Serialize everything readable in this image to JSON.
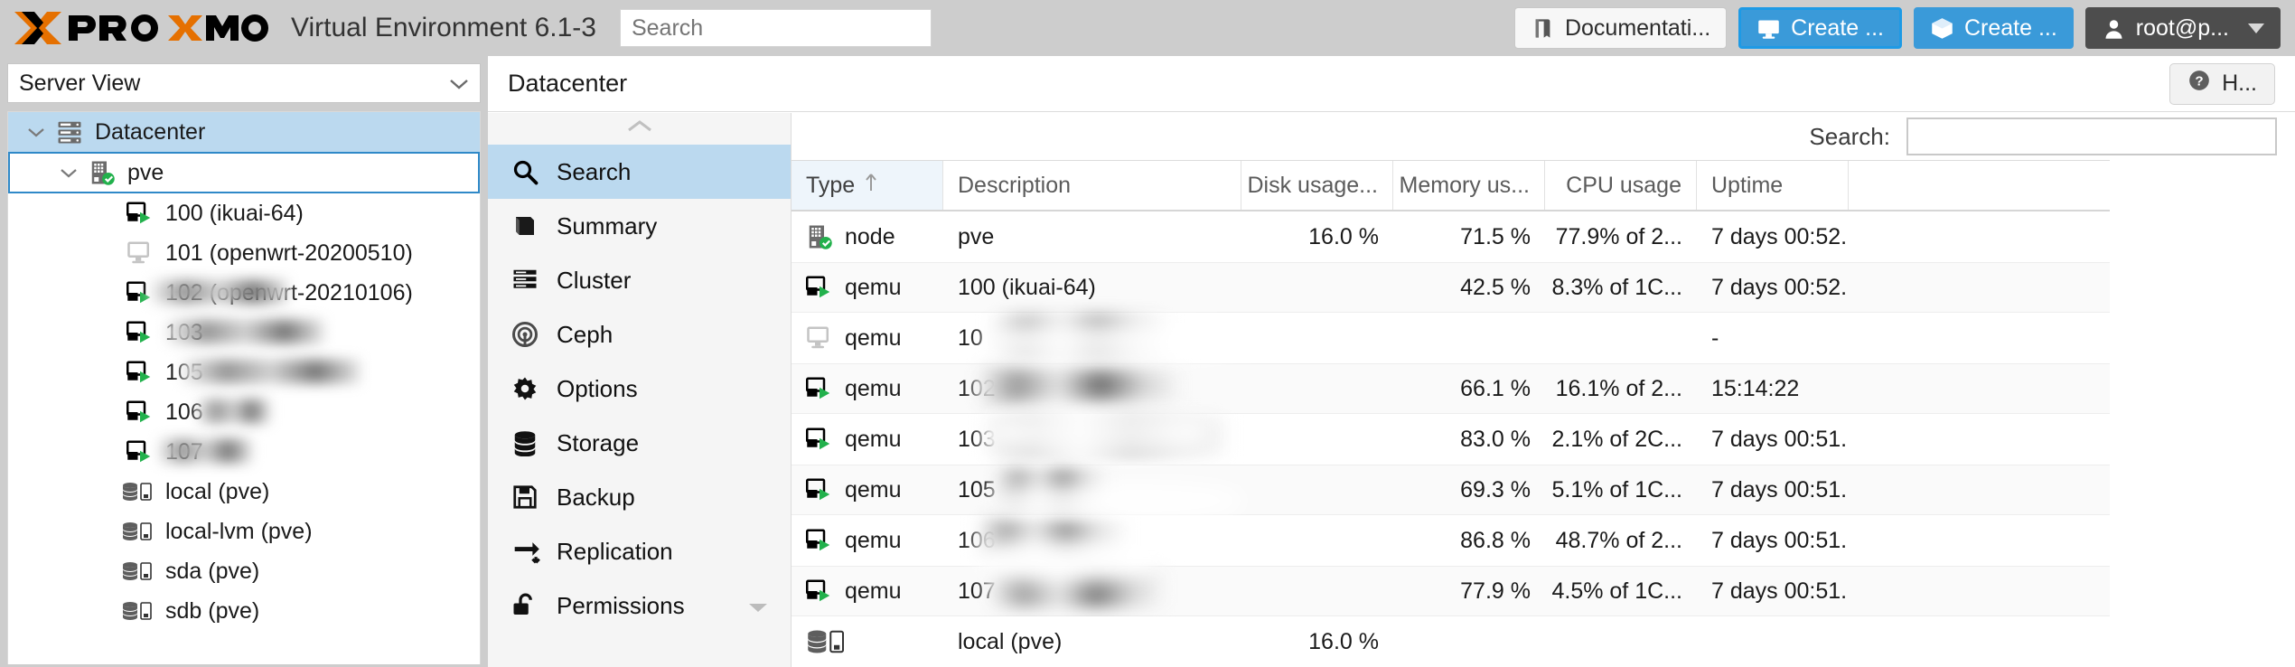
{
  "header": {
    "product": "PROXMOX",
    "title": "Virtual Environment 6.1-3",
    "search_placeholder": "Search",
    "buttons": {
      "documentation": "Documentati...",
      "create_vm": "Create ...",
      "create_ct": "Create ...",
      "user": "root@p..."
    }
  },
  "sidebar": {
    "view_label": "Server View",
    "items": [
      {
        "label": "Datacenter",
        "icon": "datacenter-icon",
        "state": "selected",
        "indent": 1,
        "twisty": "chevron-down"
      },
      {
        "label": "pve",
        "icon": "node-icon",
        "state": "focused",
        "indent": 2,
        "twisty": "chevron-down"
      },
      {
        "label": "100 (ikuai-64)",
        "icon": "qemu-running-icon",
        "state": "normal",
        "indent": 3,
        "twisty": "none"
      },
      {
        "label": "101 (openwrt-20200510)",
        "icon": "qemu-stopped-icon",
        "state": "normal",
        "indent": 3,
        "twisty": "none"
      },
      {
        "label": "102 (openwrt-20210106)",
        "icon": "qemu-running-icon",
        "state": "normal",
        "indent": 3,
        "twisty": "none",
        "redacted": true
      },
      {
        "label": "103",
        "icon": "qemu-running-icon",
        "state": "normal",
        "indent": 3,
        "twisty": "none",
        "redacted": true
      },
      {
        "label": "105",
        "icon": "qemu-running-icon",
        "state": "normal",
        "indent": 3,
        "twisty": "none",
        "redacted": true
      },
      {
        "label": "106",
        "icon": "qemu-running-icon",
        "state": "normal",
        "indent": 3,
        "twisty": "none",
        "redacted": true
      },
      {
        "label": "107",
        "icon": "qemu-running-icon",
        "state": "normal",
        "indent": 3,
        "twisty": "none",
        "redacted": true
      },
      {
        "label": "local (pve)",
        "icon": "storage-icon",
        "state": "normal",
        "indent": 3,
        "twisty": "none"
      },
      {
        "label": "local-lvm (pve)",
        "icon": "storage-icon",
        "state": "normal",
        "indent": 3,
        "twisty": "none"
      },
      {
        "label": "sda (pve)",
        "icon": "storage-icon",
        "state": "normal",
        "indent": 3,
        "twisty": "none"
      },
      {
        "label": "sdb (pve)",
        "icon": "storage-icon",
        "state": "normal",
        "indent": 3,
        "twisty": "none"
      }
    ]
  },
  "breadcrumb": {
    "label": "Datacenter"
  },
  "help_button": {
    "label": "H...",
    "icon": "question-circle-icon"
  },
  "menu": {
    "scroll_up_icon": "chevron-up-icon",
    "items": [
      {
        "label": "Search",
        "icon": "search-icon",
        "selected": true
      },
      {
        "label": "Summary",
        "icon": "book-icon",
        "selected": false
      },
      {
        "label": "Cluster",
        "icon": "server-stack-icon",
        "selected": false
      },
      {
        "label": "Ceph",
        "icon": "ceph-icon",
        "selected": false
      },
      {
        "label": "Options",
        "icon": "gear-icon",
        "selected": false
      },
      {
        "label": "Storage",
        "icon": "database-icon",
        "selected": false
      },
      {
        "label": "Backup",
        "icon": "floppy-disk-icon",
        "selected": false
      },
      {
        "label": "Replication",
        "icon": "replication-icon",
        "selected": false
      },
      {
        "label": "Permissions",
        "icon": "unlock-icon",
        "selected": false,
        "expandable": true
      }
    ]
  },
  "table_search": {
    "label": "Search:",
    "value": ""
  },
  "chart_data": {
    "type": "table",
    "title": "Datacenter Search",
    "columns": [
      "Type",
      "Description",
      "Disk usage...",
      "Memory us...",
      "CPU usage",
      "Uptime"
    ],
    "sorted_by": "Type",
    "sort_direction": "asc",
    "rows": [
      {
        "icon": "node-icon",
        "type": "node",
        "description": "pve",
        "disk": "16.0 %",
        "memory": "71.5 %",
        "cpu": "77.9% of 2...",
        "uptime": "7 days 00:52...",
        "redacted": false
      },
      {
        "icon": "qemu-running-icon",
        "type": "qemu",
        "description": "100 (ikuai-64)",
        "disk": "",
        "memory": "42.5 %",
        "cpu": "8.3% of 1C...",
        "uptime": "7 days 00:52...",
        "redacted": false
      },
      {
        "icon": "qemu-stopped-icon",
        "type": "qemu",
        "description": "10",
        "disk": "",
        "memory": "",
        "cpu": "",
        "uptime": "-",
        "redacted": true
      },
      {
        "icon": "qemu-running-icon",
        "type": "qemu",
        "description": "102",
        "disk": "",
        "memory": "66.1 %",
        "cpu": "16.1% of 2...",
        "uptime": "15:14:22",
        "redacted": true
      },
      {
        "icon": "qemu-running-icon",
        "type": "qemu",
        "description": "103",
        "disk": "",
        "memory": "83.0 %",
        "cpu": "2.1% of 2C...",
        "uptime": "7 days 00:51...",
        "redacted": true
      },
      {
        "icon": "qemu-running-icon",
        "type": "qemu",
        "description": "105",
        "disk": "",
        "memory": "69.3 %",
        "cpu": "5.1% of 1C...",
        "uptime": "7 days 00:51...",
        "redacted": true
      },
      {
        "icon": "qemu-running-icon",
        "type": "qemu",
        "description": "106",
        "disk": "",
        "memory": "86.8 %",
        "cpu": "48.7% of 2...",
        "uptime": "7 days 00:51...",
        "redacted": true
      },
      {
        "icon": "qemu-running-icon",
        "type": "qemu",
        "description": "107",
        "disk": "",
        "memory": "77.9 %",
        "cpu": "4.5% of 1C...",
        "uptime": "7 days 00:51...",
        "redacted": true
      },
      {
        "icon": "storage-icon",
        "type": "",
        "description": "local (pve)",
        "disk": "16.0 %",
        "memory": "",
        "cpu": "",
        "uptime": "",
        "redacted": false
      }
    ]
  },
  "colors": {
    "header_bg": "#cdcdcd",
    "accent_blue": "#3a9ad9",
    "selection_blue": "#bbd9ef",
    "focus_border": "#2f89c8",
    "running_green": "#22b14c",
    "logo_orange": "#e57000",
    "user_dark": "#4d4d4d"
  }
}
